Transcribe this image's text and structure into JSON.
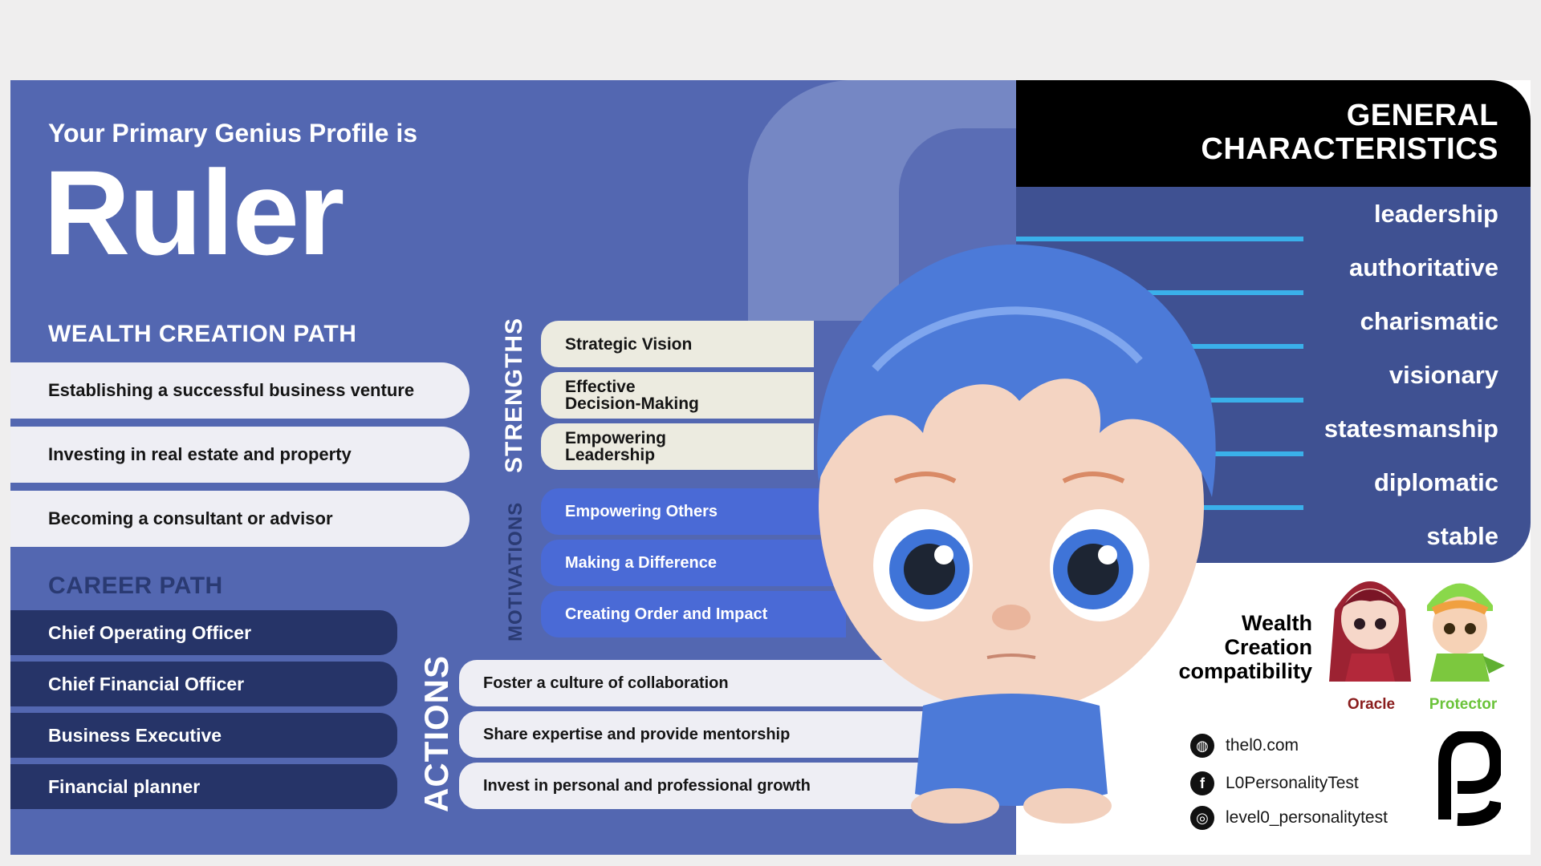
{
  "header": {
    "subtitle": "Your Primary Genius Profile is",
    "title": "Ruler"
  },
  "wealth_creation": {
    "heading": "WEALTH CREATION PATH",
    "items": [
      "Establishing a successful business venture",
      "Investing in real estate and property",
      "Becoming a consultant or advisor"
    ]
  },
  "career": {
    "heading": "CAREER PATH",
    "items": [
      "Chief Operating Officer",
      "Chief Financial Officer",
      "Business Executive",
      "Financial planner"
    ]
  },
  "strengths": {
    "label": "STRENGTHS",
    "items": [
      [
        "Strategic Vision"
      ],
      [
        "Effective",
        "Decision-Making"
      ],
      [
        "Empowering",
        "Leadership"
      ]
    ]
  },
  "motivations": {
    "label": "MOTIVATIONS",
    "items": [
      "Empowering Others",
      "Making a Difference",
      "Creating Order and Impact"
    ]
  },
  "actions": {
    "label": "ACTIONS",
    "items": [
      "Foster a culture of collaboration",
      "Share expertise and provide mentorship",
      "Invest in personal and professional growth"
    ]
  },
  "general_characteristics": {
    "title_line1": "GENERAL",
    "title_line2": "CHARACTERISTICS",
    "items": [
      "leadership",
      "authoritative",
      "charismatic",
      "visionary",
      "statesmanship",
      "diplomatic",
      "stable"
    ]
  },
  "compatibility": {
    "label_line1": "Wealth",
    "label_line2": "Creation",
    "label_line3": "compatibility",
    "oracle": "Oracle",
    "protector": "Protector"
  },
  "social": {
    "website": "thel0.com",
    "facebook": "L0PersonalityTest",
    "instagram": "level0_personalitytest"
  },
  "colors": {
    "panel_blue": "#5367b1",
    "career_navy": "#263468",
    "motivation_blue": "#4a6ad6",
    "accent_cyan": "#3ab0ea",
    "oracle_red": "#8a1d1d",
    "protector_green": "#6bc33a"
  },
  "icons": [
    "globe-icon",
    "facebook-icon",
    "instagram-icon",
    "level0-logo"
  ]
}
